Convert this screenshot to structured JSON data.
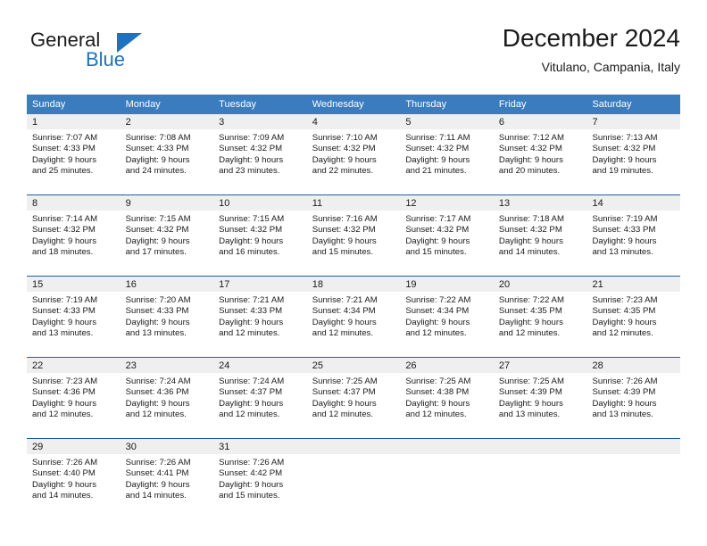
{
  "brand": {
    "name_part1": "General",
    "name_part2": "Blue",
    "flag_icon": "flag-triangle-icon"
  },
  "header": {
    "month_title": "December 2024",
    "location": "Vitulano, Campania, Italy"
  },
  "colors": {
    "header_blue": "#3a7cbe",
    "row_divider_blue": "#1f5fa0",
    "brand_blue": "#1f72bd",
    "day_strip_gray": "#efefef",
    "text": "#1a1a1a"
  },
  "weekdays": [
    "Sunday",
    "Monday",
    "Tuesday",
    "Wednesday",
    "Thursday",
    "Friday",
    "Saturday"
  ],
  "weeks": [
    [
      {
        "day": "1",
        "sunrise": "Sunrise: 7:07 AM",
        "sunset": "Sunset: 4:33 PM",
        "daylight_line1": "Daylight: 9 hours",
        "daylight_line2": "and 25 minutes."
      },
      {
        "day": "2",
        "sunrise": "Sunrise: 7:08 AM",
        "sunset": "Sunset: 4:33 PM",
        "daylight_line1": "Daylight: 9 hours",
        "daylight_line2": "and 24 minutes."
      },
      {
        "day": "3",
        "sunrise": "Sunrise: 7:09 AM",
        "sunset": "Sunset: 4:32 PM",
        "daylight_line1": "Daylight: 9 hours",
        "daylight_line2": "and 23 minutes."
      },
      {
        "day": "4",
        "sunrise": "Sunrise: 7:10 AM",
        "sunset": "Sunset: 4:32 PM",
        "daylight_line1": "Daylight: 9 hours",
        "daylight_line2": "and 22 minutes."
      },
      {
        "day": "5",
        "sunrise": "Sunrise: 7:11 AM",
        "sunset": "Sunset: 4:32 PM",
        "daylight_line1": "Daylight: 9 hours",
        "daylight_line2": "and 21 minutes."
      },
      {
        "day": "6",
        "sunrise": "Sunrise: 7:12 AM",
        "sunset": "Sunset: 4:32 PM",
        "daylight_line1": "Daylight: 9 hours",
        "daylight_line2": "and 20 minutes."
      },
      {
        "day": "7",
        "sunrise": "Sunrise: 7:13 AM",
        "sunset": "Sunset: 4:32 PM",
        "daylight_line1": "Daylight: 9 hours",
        "daylight_line2": "and 19 minutes."
      }
    ],
    [
      {
        "day": "8",
        "sunrise": "Sunrise: 7:14 AM",
        "sunset": "Sunset: 4:32 PM",
        "daylight_line1": "Daylight: 9 hours",
        "daylight_line2": "and 18 minutes."
      },
      {
        "day": "9",
        "sunrise": "Sunrise: 7:15 AM",
        "sunset": "Sunset: 4:32 PM",
        "daylight_line1": "Daylight: 9 hours",
        "daylight_line2": "and 17 minutes."
      },
      {
        "day": "10",
        "sunrise": "Sunrise: 7:15 AM",
        "sunset": "Sunset: 4:32 PM",
        "daylight_line1": "Daylight: 9 hours",
        "daylight_line2": "and 16 minutes."
      },
      {
        "day": "11",
        "sunrise": "Sunrise: 7:16 AM",
        "sunset": "Sunset: 4:32 PM",
        "daylight_line1": "Daylight: 9 hours",
        "daylight_line2": "and 15 minutes."
      },
      {
        "day": "12",
        "sunrise": "Sunrise: 7:17 AM",
        "sunset": "Sunset: 4:32 PM",
        "daylight_line1": "Daylight: 9 hours",
        "daylight_line2": "and 15 minutes."
      },
      {
        "day": "13",
        "sunrise": "Sunrise: 7:18 AM",
        "sunset": "Sunset: 4:32 PM",
        "daylight_line1": "Daylight: 9 hours",
        "daylight_line2": "and 14 minutes."
      },
      {
        "day": "14",
        "sunrise": "Sunrise: 7:19 AM",
        "sunset": "Sunset: 4:33 PM",
        "daylight_line1": "Daylight: 9 hours",
        "daylight_line2": "and 13 minutes."
      }
    ],
    [
      {
        "day": "15",
        "sunrise": "Sunrise: 7:19 AM",
        "sunset": "Sunset: 4:33 PM",
        "daylight_line1": "Daylight: 9 hours",
        "daylight_line2": "and 13 minutes."
      },
      {
        "day": "16",
        "sunrise": "Sunrise: 7:20 AM",
        "sunset": "Sunset: 4:33 PM",
        "daylight_line1": "Daylight: 9 hours",
        "daylight_line2": "and 13 minutes."
      },
      {
        "day": "17",
        "sunrise": "Sunrise: 7:21 AM",
        "sunset": "Sunset: 4:33 PM",
        "daylight_line1": "Daylight: 9 hours",
        "daylight_line2": "and 12 minutes."
      },
      {
        "day": "18",
        "sunrise": "Sunrise: 7:21 AM",
        "sunset": "Sunset: 4:34 PM",
        "daylight_line1": "Daylight: 9 hours",
        "daylight_line2": "and 12 minutes."
      },
      {
        "day": "19",
        "sunrise": "Sunrise: 7:22 AM",
        "sunset": "Sunset: 4:34 PM",
        "daylight_line1": "Daylight: 9 hours",
        "daylight_line2": "and 12 minutes."
      },
      {
        "day": "20",
        "sunrise": "Sunrise: 7:22 AM",
        "sunset": "Sunset: 4:35 PM",
        "daylight_line1": "Daylight: 9 hours",
        "daylight_line2": "and 12 minutes."
      },
      {
        "day": "21",
        "sunrise": "Sunrise: 7:23 AM",
        "sunset": "Sunset: 4:35 PM",
        "daylight_line1": "Daylight: 9 hours",
        "daylight_line2": "and 12 minutes."
      }
    ],
    [
      {
        "day": "22",
        "sunrise": "Sunrise: 7:23 AM",
        "sunset": "Sunset: 4:36 PM",
        "daylight_line1": "Daylight: 9 hours",
        "daylight_line2": "and 12 minutes."
      },
      {
        "day": "23",
        "sunrise": "Sunrise: 7:24 AM",
        "sunset": "Sunset: 4:36 PM",
        "daylight_line1": "Daylight: 9 hours",
        "daylight_line2": "and 12 minutes."
      },
      {
        "day": "24",
        "sunrise": "Sunrise: 7:24 AM",
        "sunset": "Sunset: 4:37 PM",
        "daylight_line1": "Daylight: 9 hours",
        "daylight_line2": "and 12 minutes."
      },
      {
        "day": "25",
        "sunrise": "Sunrise: 7:25 AM",
        "sunset": "Sunset: 4:37 PM",
        "daylight_line1": "Daylight: 9 hours",
        "daylight_line2": "and 12 minutes."
      },
      {
        "day": "26",
        "sunrise": "Sunrise: 7:25 AM",
        "sunset": "Sunset: 4:38 PM",
        "daylight_line1": "Daylight: 9 hours",
        "daylight_line2": "and 12 minutes."
      },
      {
        "day": "27",
        "sunrise": "Sunrise: 7:25 AM",
        "sunset": "Sunset: 4:39 PM",
        "daylight_line1": "Daylight: 9 hours",
        "daylight_line2": "and 13 minutes."
      },
      {
        "day": "28",
        "sunrise": "Sunrise: 7:26 AM",
        "sunset": "Sunset: 4:39 PM",
        "daylight_line1": "Daylight: 9 hours",
        "daylight_line2": "and 13 minutes."
      }
    ],
    [
      {
        "day": "29",
        "sunrise": "Sunrise: 7:26 AM",
        "sunset": "Sunset: 4:40 PM",
        "daylight_line1": "Daylight: 9 hours",
        "daylight_line2": "and 14 minutes."
      },
      {
        "day": "30",
        "sunrise": "Sunrise: 7:26 AM",
        "sunset": "Sunset: 4:41 PM",
        "daylight_line1": "Daylight: 9 hours",
        "daylight_line2": "and 14 minutes."
      },
      {
        "day": "31",
        "sunrise": "Sunrise: 7:26 AM",
        "sunset": "Sunset: 4:42 PM",
        "daylight_line1": "Daylight: 9 hours",
        "daylight_line2": "and 15 minutes."
      },
      {
        "day": "",
        "sunrise": "",
        "sunset": "",
        "daylight_line1": "",
        "daylight_line2": ""
      },
      {
        "day": "",
        "sunrise": "",
        "sunset": "",
        "daylight_line1": "",
        "daylight_line2": ""
      },
      {
        "day": "",
        "sunrise": "",
        "sunset": "",
        "daylight_line1": "",
        "daylight_line2": ""
      },
      {
        "day": "",
        "sunrise": "",
        "sunset": "",
        "daylight_line1": "",
        "daylight_line2": ""
      }
    ]
  ]
}
